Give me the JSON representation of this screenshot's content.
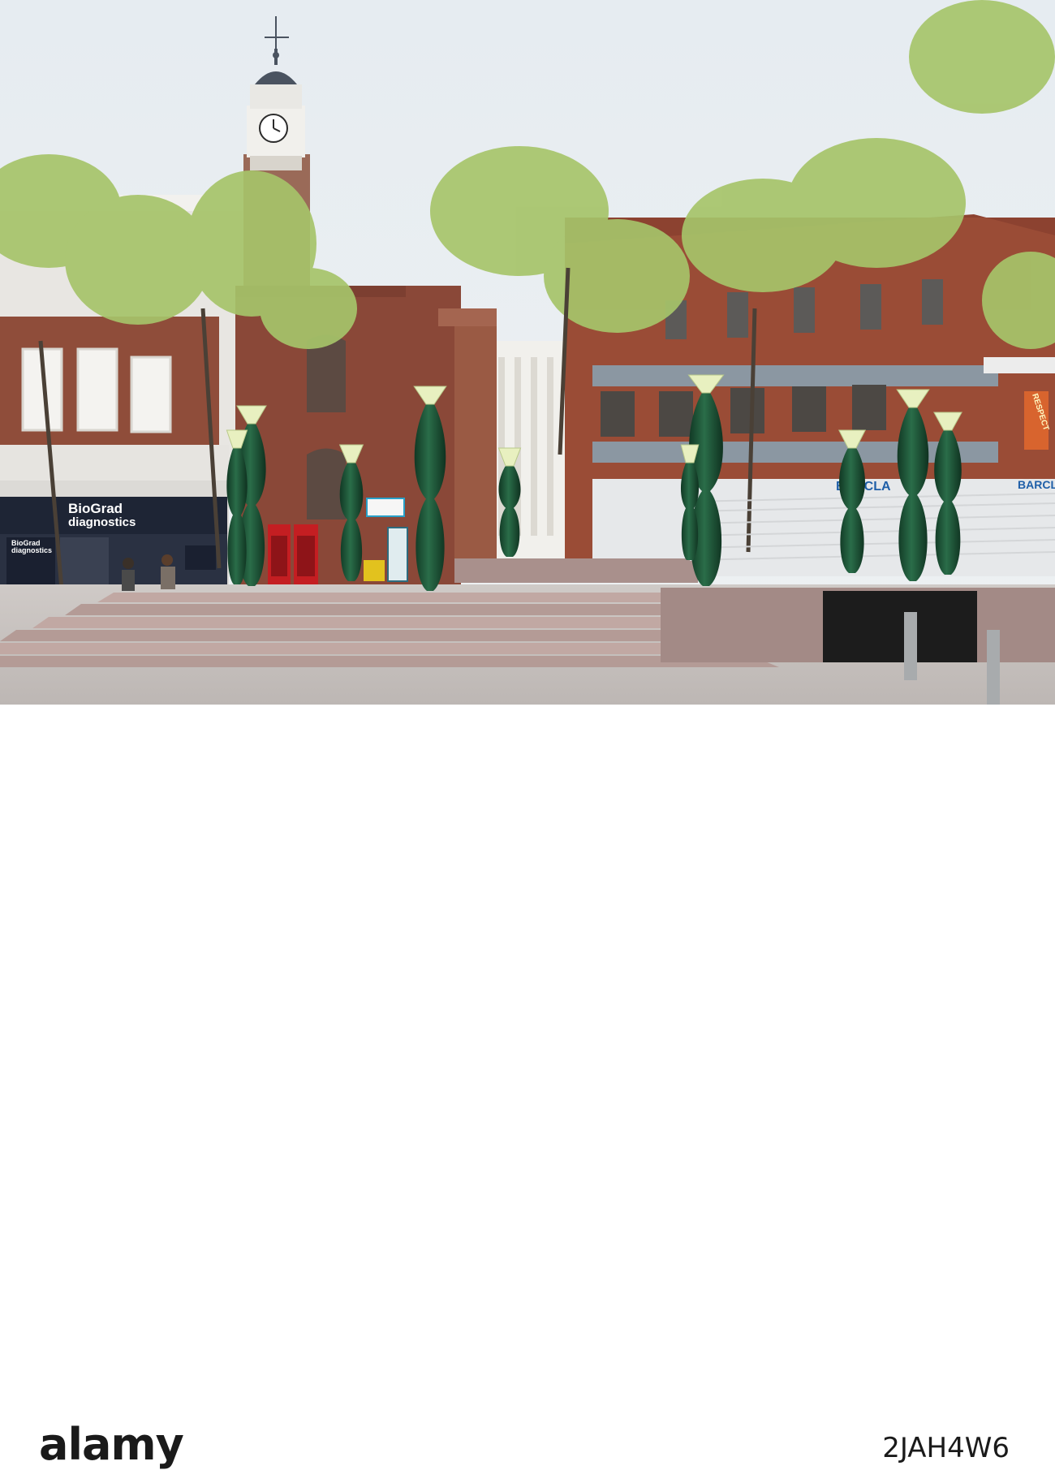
{
  "scene": {
    "shop_sign_line1": "BioGrad",
    "shop_sign_line2": "diagnostics",
    "window_sign_line1": "BioGrad",
    "window_sign_line2": "diagnostics",
    "bank_sign_left": "BARCLA",
    "bank_sign_right": "BARCLA",
    "banner_text": "RESPECT",
    "colors": {
      "sky": "#e9eef2",
      "brick": "#8e4a36",
      "sandstone": "#8a4838",
      "column_green": "#1f5a3c",
      "lamp_glow": "#e8f0c0",
      "paving": "#c9c4c2",
      "steps": "#b39a96"
    }
  },
  "watermark": {
    "logo": "alamy",
    "image_id": "2JAH4W6"
  }
}
